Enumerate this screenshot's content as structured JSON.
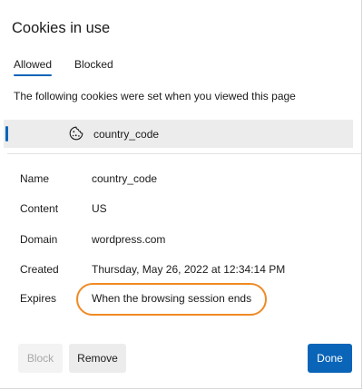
{
  "dialog": {
    "title": "Cookies in use",
    "tabs": [
      {
        "label": "Allowed",
        "active": true
      },
      {
        "label": "Blocked",
        "active": false
      }
    ],
    "description": "The following cookies were set when you viewed this page",
    "selected_cookie": {
      "icon": "cookie-icon",
      "name": "country_code"
    },
    "details": {
      "name_label": "Name",
      "name_value": "country_code",
      "content_label": "Content",
      "content_value": "US",
      "domain_label": "Domain",
      "domain_value": "wordpress.com",
      "created_label": "Created",
      "created_value": "Thursday, May 26, 2022 at 12:34:14 PM",
      "expires_label": "Expires",
      "expires_value": "When the browsing session ends"
    },
    "buttons": {
      "block": "Block",
      "remove": "Remove",
      "done": "Done"
    }
  },
  "colors": {
    "accent": "#0a65b8",
    "highlight": "#f08a24",
    "selected_row_bg": "#ececec"
  }
}
